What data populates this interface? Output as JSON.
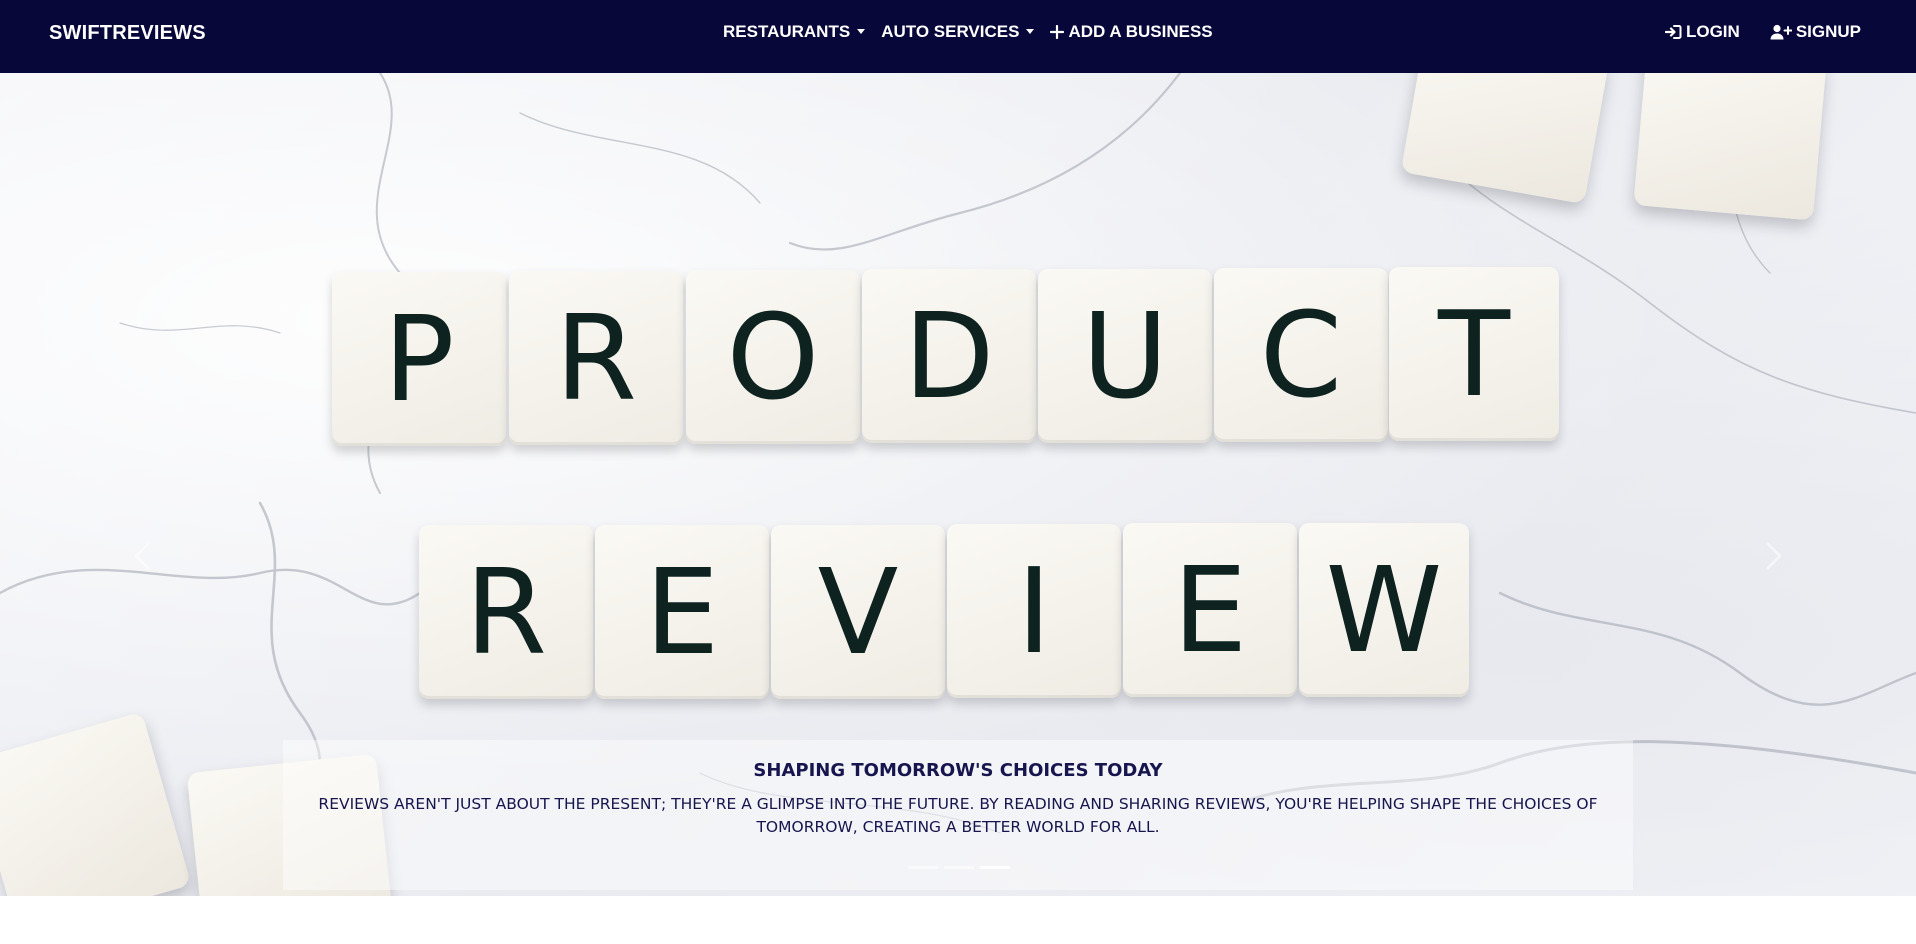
{
  "nav": {
    "brand": "SWIFTREVIEWS",
    "items": [
      {
        "label": "RESTAURANTS",
        "dropdown": true
      },
      {
        "label": "AUTO SERVICES",
        "dropdown": true
      },
      {
        "label": "ADD A BUSINESS",
        "icon": "plus-icon"
      }
    ],
    "login": {
      "label": "LOGIN",
      "icon": "login-icon"
    },
    "signup": {
      "label": "SIGNUP",
      "icon": "user-plus-icon"
    }
  },
  "hero": {
    "word_one": [
      "P",
      "R",
      "O",
      "D",
      "U",
      "C",
      "T"
    ],
    "word_two": [
      "R",
      "E",
      "V",
      "I",
      "E",
      "W"
    ],
    "caption_title": "SHAPING TOMORROW'S CHOICES TODAY",
    "caption_text": "REVIEWS AREN'T JUST ABOUT THE PRESENT; THEY'RE A GLIMPSE INTO THE FUTURE. BY READING AND SHARING REVIEWS, YOU'RE HELPING SHAPE THE CHOICES OF TOMORROW, CREATING A BETTER WORLD FOR ALL.",
    "slides_total": 3,
    "active_slide": 3
  },
  "colors": {
    "navbar_bg": "#07073a",
    "caption_text": "#17154d",
    "tile_letter": "#0e2220"
  }
}
